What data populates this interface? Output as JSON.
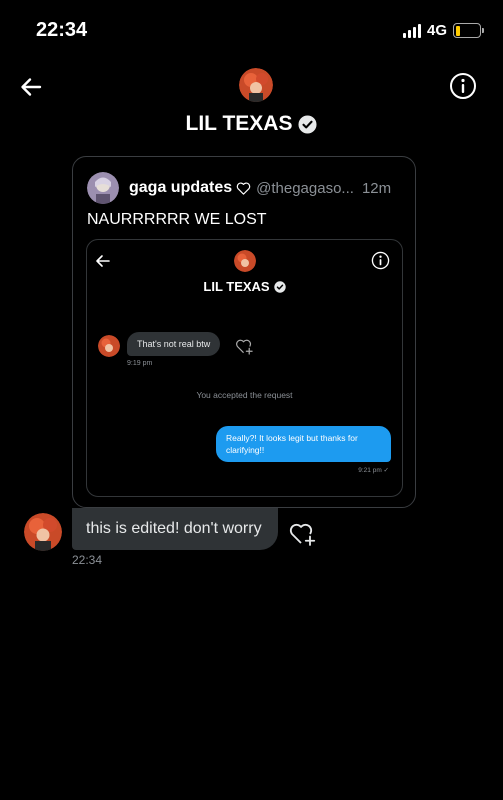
{
  "status_bar": {
    "time": "22:34",
    "network": "4G",
    "battery_level": 0.18
  },
  "header": {
    "name": "LIL TEXAS"
  },
  "quoted_tweet": {
    "display_name": "gaga updates",
    "handle": "@thegagaso...",
    "time_ago": "12m",
    "text": "NAURRRRRR WE LOST",
    "screenshot": {
      "name": "LIL TEXAS",
      "incoming_message": "That's not real btw",
      "incoming_time": "9:19 pm",
      "system_text": "You accepted the request",
      "outgoing_message": "Really?! It looks legit but thanks for clarifying!!",
      "outgoing_time": "9:21 pm ✓"
    }
  },
  "message": {
    "text": "this is edited! don't worry",
    "time": "22:34"
  },
  "colors": {
    "accent_blue": "#1d9bf0",
    "bubble_gray": "#2f3336",
    "battery_yellow": "#ffcc00"
  }
}
